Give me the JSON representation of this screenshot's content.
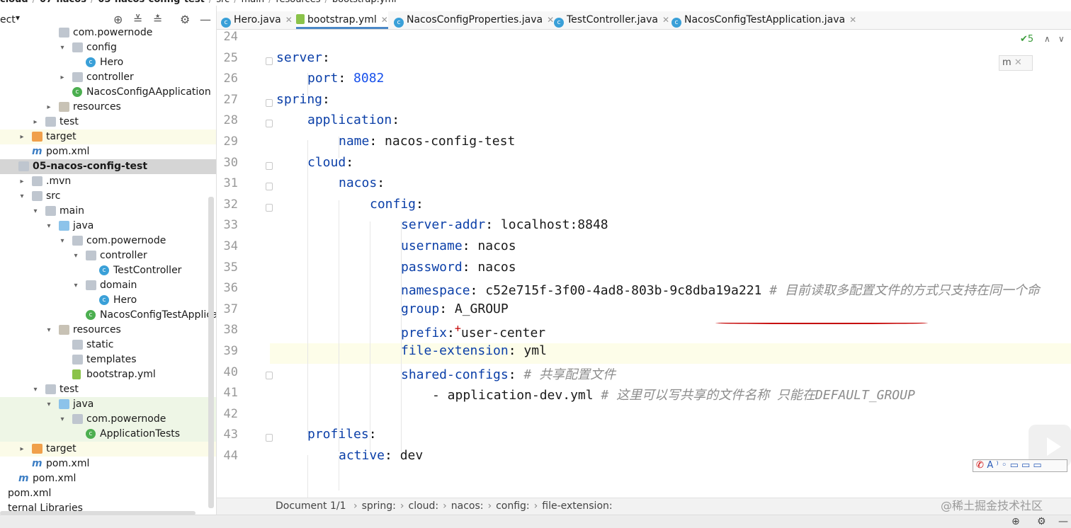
{
  "breadcrumb": [
    "cloud",
    "07-nacos",
    "05-nacos-config-test",
    "src",
    "main",
    "resources",
    "bootstrap.yml"
  ],
  "project_header": {
    "title": "ect"
  },
  "tree": [
    {
      "label": "com.powernode",
      "arrow": "",
      "icon": "folder",
      "indent": 1
    },
    {
      "label": "config",
      "arrow": "open",
      "icon": "folder",
      "indent": 2
    },
    {
      "label": "Hero",
      "arrow": "",
      "icon": "class",
      "indent": 3
    },
    {
      "label": "controller",
      "arrow": "closed",
      "icon": "folder",
      "indent": 2
    },
    {
      "label": "NacosConfigAApplication",
      "arrow": "",
      "icon": "app",
      "indent": 2
    },
    {
      "label": "resources",
      "arrow": "closed",
      "icon": "res",
      "indent": 1
    },
    {
      "label": "test",
      "arrow": "closed",
      "icon": "folder",
      "indent": 0
    },
    {
      "label": "target",
      "arrow": "closed",
      "icon": "orange",
      "indent": -1,
      "style": "yellow"
    },
    {
      "label": "pom.xml",
      "arrow": "",
      "icon": "maven",
      "indent": -1
    },
    {
      "label": "05-nacos-config-test",
      "arrow": "",
      "icon": "folder",
      "indent": -2,
      "style": "sel",
      "bold": true
    },
    {
      "label": ".mvn",
      "arrow": "closed",
      "icon": "folder",
      "indent": -1
    },
    {
      "label": "src",
      "arrow": "open",
      "icon": "folder",
      "indent": -1
    },
    {
      "label": "main",
      "arrow": "open",
      "icon": "folder",
      "indent": 0
    },
    {
      "label": "java",
      "arrow": "open",
      "icon": "blue",
      "indent": 1
    },
    {
      "label": "com.powernode",
      "arrow": "open",
      "icon": "folder",
      "indent": 2
    },
    {
      "label": "controller",
      "arrow": "open",
      "icon": "folder",
      "indent": 3
    },
    {
      "label": "TestController",
      "arrow": "",
      "icon": "class",
      "indent": 4
    },
    {
      "label": "domain",
      "arrow": "open",
      "icon": "folder",
      "indent": 3
    },
    {
      "label": "Hero",
      "arrow": "",
      "icon": "class",
      "indent": 4
    },
    {
      "label": "NacosConfigTestApplication",
      "arrow": "",
      "icon": "app",
      "indent": 3
    },
    {
      "label": "resources",
      "arrow": "open",
      "icon": "res",
      "indent": 1
    },
    {
      "label": "static",
      "arrow": "",
      "icon": "folder",
      "indent": 2
    },
    {
      "label": "templates",
      "arrow": "",
      "icon": "folder",
      "indent": 2
    },
    {
      "label": "bootstrap.yml",
      "arrow": "",
      "icon": "yml",
      "indent": 2
    },
    {
      "label": "test",
      "arrow": "open",
      "icon": "folder",
      "indent": 0
    },
    {
      "label": "java",
      "arrow": "open",
      "icon": "blue",
      "indent": 1,
      "style": "green"
    },
    {
      "label": "com.powernode",
      "arrow": "open",
      "icon": "folder",
      "indent": 2,
      "style": "green"
    },
    {
      "label": "ApplicationTests",
      "arrow": "",
      "icon": "app",
      "indent": 3,
      "style": "green"
    },
    {
      "label": "target",
      "arrow": "closed",
      "icon": "orange",
      "indent": -1,
      "style": "yellow"
    },
    {
      "label": "pom.xml",
      "arrow": "",
      "icon": "maven",
      "indent": -1
    },
    {
      "label": "pom.xml",
      "arrow": "",
      "icon": "maven",
      "indent": -2
    },
    {
      "label": "pom.xml",
      "arrow": "",
      "icon": "none",
      "indent": -3
    },
    {
      "label": "ternal Libraries",
      "arrow": "",
      "icon": "none",
      "indent": -3
    }
  ],
  "tabs": [
    {
      "label": "Hero.java",
      "icon": "class"
    },
    {
      "label": "bootstrap.yml",
      "icon": "yml",
      "active": true
    },
    {
      "label": "NacosConfigProperties.java",
      "icon": "class"
    },
    {
      "label": "TestController.java",
      "icon": "class"
    },
    {
      "label": "NacosConfigTestApplication.java",
      "icon": "class"
    }
  ],
  "editor": {
    "inspection_count": "5",
    "lines": [
      {
        "n": "24",
        "indent": 0,
        "key": "",
        "val": "",
        "comment": ""
      },
      {
        "n": "25",
        "indent": 0,
        "key": "server",
        "val": "",
        "comment": ""
      },
      {
        "n": "26",
        "indent": 1,
        "key": "port",
        "val": "8082",
        "num": true,
        "comment": ""
      },
      {
        "n": "27",
        "indent": 0,
        "key": "spring",
        "val": "",
        "comment": ""
      },
      {
        "n": "28",
        "indent": 1,
        "key": "application",
        "val": "",
        "comment": ""
      },
      {
        "n": "29",
        "indent": 2,
        "key": "name",
        "val": "nacos-config-test",
        "comment": ""
      },
      {
        "n": "30",
        "indent": 1,
        "key": "cloud",
        "val": "",
        "comment": ""
      },
      {
        "n": "31",
        "indent": 2,
        "key": "nacos",
        "val": "",
        "comment": ""
      },
      {
        "n": "32",
        "indent": 3,
        "key": "config",
        "val": "",
        "comment": ""
      },
      {
        "n": "33",
        "indent": 4,
        "key": "server-addr",
        "val": "localhost:8848",
        "comment": ""
      },
      {
        "n": "34",
        "indent": 4,
        "key": "username",
        "val": "nacos",
        "comment": ""
      },
      {
        "n": "35",
        "indent": 4,
        "key": "password",
        "val": "nacos",
        "comment": ""
      },
      {
        "n": "36",
        "indent": 4,
        "key": "namespace",
        "val": "c52e715f-3f00-4ad8-803b-9c8dba19a221",
        "comment": "# 目前读取多配置文件的方式只支持在同一个命"
      },
      {
        "n": "37",
        "indent": 4,
        "key": "group",
        "val": "A_GROUP",
        "comment": ""
      },
      {
        "n": "38",
        "indent": 4,
        "key": "prefix",
        "val": "user-center",
        "comment": "",
        "plus": true
      },
      {
        "n": "39",
        "indent": 4,
        "key": "file-extension",
        "val": "yml",
        "comment": "",
        "current": true
      },
      {
        "n": "40",
        "indent": 4,
        "key": "shared-configs",
        "val": "",
        "comment": "# 共享配置文件"
      },
      {
        "n": "41",
        "indent": 5,
        "key": "",
        "val": "- application-dev.yml",
        "comment": "# 这里可以写共享的文件名称 只能在DEFAULT_GROUP"
      },
      {
        "n": "42",
        "indent": 0,
        "key": "",
        "val": "",
        "comment": ""
      },
      {
        "n": "43",
        "indent": 1,
        "key": "profiles",
        "val": "",
        "comment": ""
      },
      {
        "n": "44",
        "indent": 2,
        "key": "active",
        "val": "dev",
        "comment": ""
      }
    ]
  },
  "status": {
    "document": "Document 1/1",
    "path": [
      "spring:",
      "cloud:",
      "nacos:",
      "config:",
      "file-extension:"
    ]
  },
  "watermark": "@稀土掘金技术社区",
  "ime_label": "A ⁾ ◦ ▭ ▭ ▭",
  "colors": {
    "key": "#0b3fa8",
    "number": "#1750eb",
    "comment": "#8c8c8c",
    "accent": "#4a88c7",
    "underline": "#c40000"
  }
}
